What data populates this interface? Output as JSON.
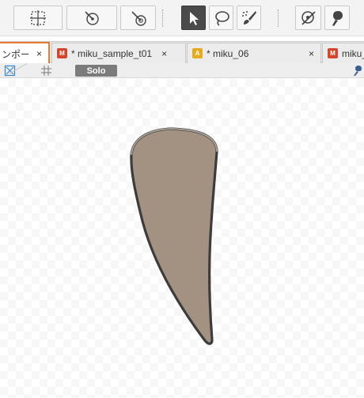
{
  "toolbar": {
    "buttons": [
      {
        "icon": "transform-select-icon"
      },
      {
        "icon": "pen-node-icon"
      },
      {
        "icon": "multi-node-icon"
      },
      {
        "icon": "arrow-select-icon",
        "active": true
      },
      {
        "icon": "lasso-icon"
      },
      {
        "icon": "brush-icon"
      },
      {
        "icon": "eyedropper-node-icon"
      },
      {
        "icon": "fill-tool-icon"
      }
    ]
  },
  "tabs": [
    {
      "label": "ンポート",
      "close": "×",
      "active": true
    },
    {
      "badge": "M",
      "label": "* miku_sample_t01",
      "close": "×"
    },
    {
      "badge": "A",
      "label": "* miku_06",
      "close": "×"
    },
    {
      "badge": "M",
      "label": "miku_"
    }
  ],
  "subbar": {
    "solo_label": "Solo"
  },
  "colors": {
    "accent": "#e57b2f",
    "shape_fill": "#a39282",
    "shape_stroke": "#3c3c3c",
    "active_tool": "#4a4a4a"
  }
}
